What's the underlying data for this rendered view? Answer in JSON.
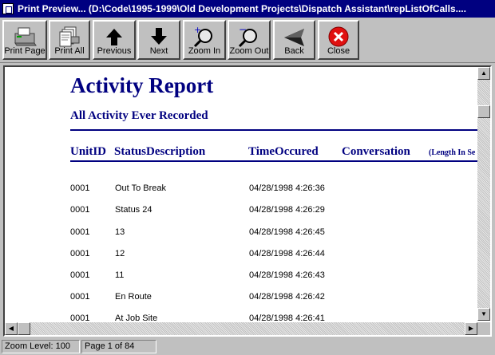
{
  "window": {
    "title": "Print Preview...  (D:\\Code\\1995-1999\\Old Development Projects\\Dispatch Assistant\\repListOfCalls...."
  },
  "toolbar": {
    "buttons": [
      {
        "label": "Print Page",
        "icon": "printer-icon"
      },
      {
        "label": "Print All",
        "icon": "print-all-icon"
      },
      {
        "label": "Previous",
        "icon": "arrow-up-icon"
      },
      {
        "label": "Next",
        "icon": "arrow-down-icon"
      },
      {
        "label": "Zoom In",
        "icon": "zoom-in-icon"
      },
      {
        "label": "Zoom Out",
        "icon": "zoom-out-icon"
      },
      {
        "label": "Back",
        "icon": "back-arrow-icon"
      },
      {
        "label": "Close",
        "icon": "close-icon"
      }
    ]
  },
  "report": {
    "title": "Activity Report",
    "subtitle": "All Activity Ever Recorded",
    "columns": [
      "UnitID",
      "StatusDescription",
      "TimeOccured",
      "Conversation",
      "(Length In Se"
    ],
    "rows": [
      {
        "unit": "0001",
        "status": "Out To Break",
        "time": "04/28/1998 4:26:36"
      },
      {
        "unit": "0001",
        "status": "Status 24",
        "time": "04/28/1998 4:26:29"
      },
      {
        "unit": "0001",
        "status": "13",
        "time": "04/28/1998 4:26:45"
      },
      {
        "unit": "0001",
        "status": "12",
        "time": "04/28/1998 4:26:44"
      },
      {
        "unit": "0001",
        "status": "11",
        "time": "04/28/1998 4:26:43"
      },
      {
        "unit": "0001",
        "status": "En Route",
        "time": "04/28/1998 4:26:42"
      },
      {
        "unit": "0001",
        "status": "At Job Site",
        "time": "04/28/1998 4:26:41"
      }
    ]
  },
  "statusbar": {
    "zoom": "Zoom Level: 100",
    "page": "Page 1 of 84"
  },
  "colors": {
    "title_bar": "#000080",
    "report_text": "#000080",
    "close_red": "#e01010"
  }
}
